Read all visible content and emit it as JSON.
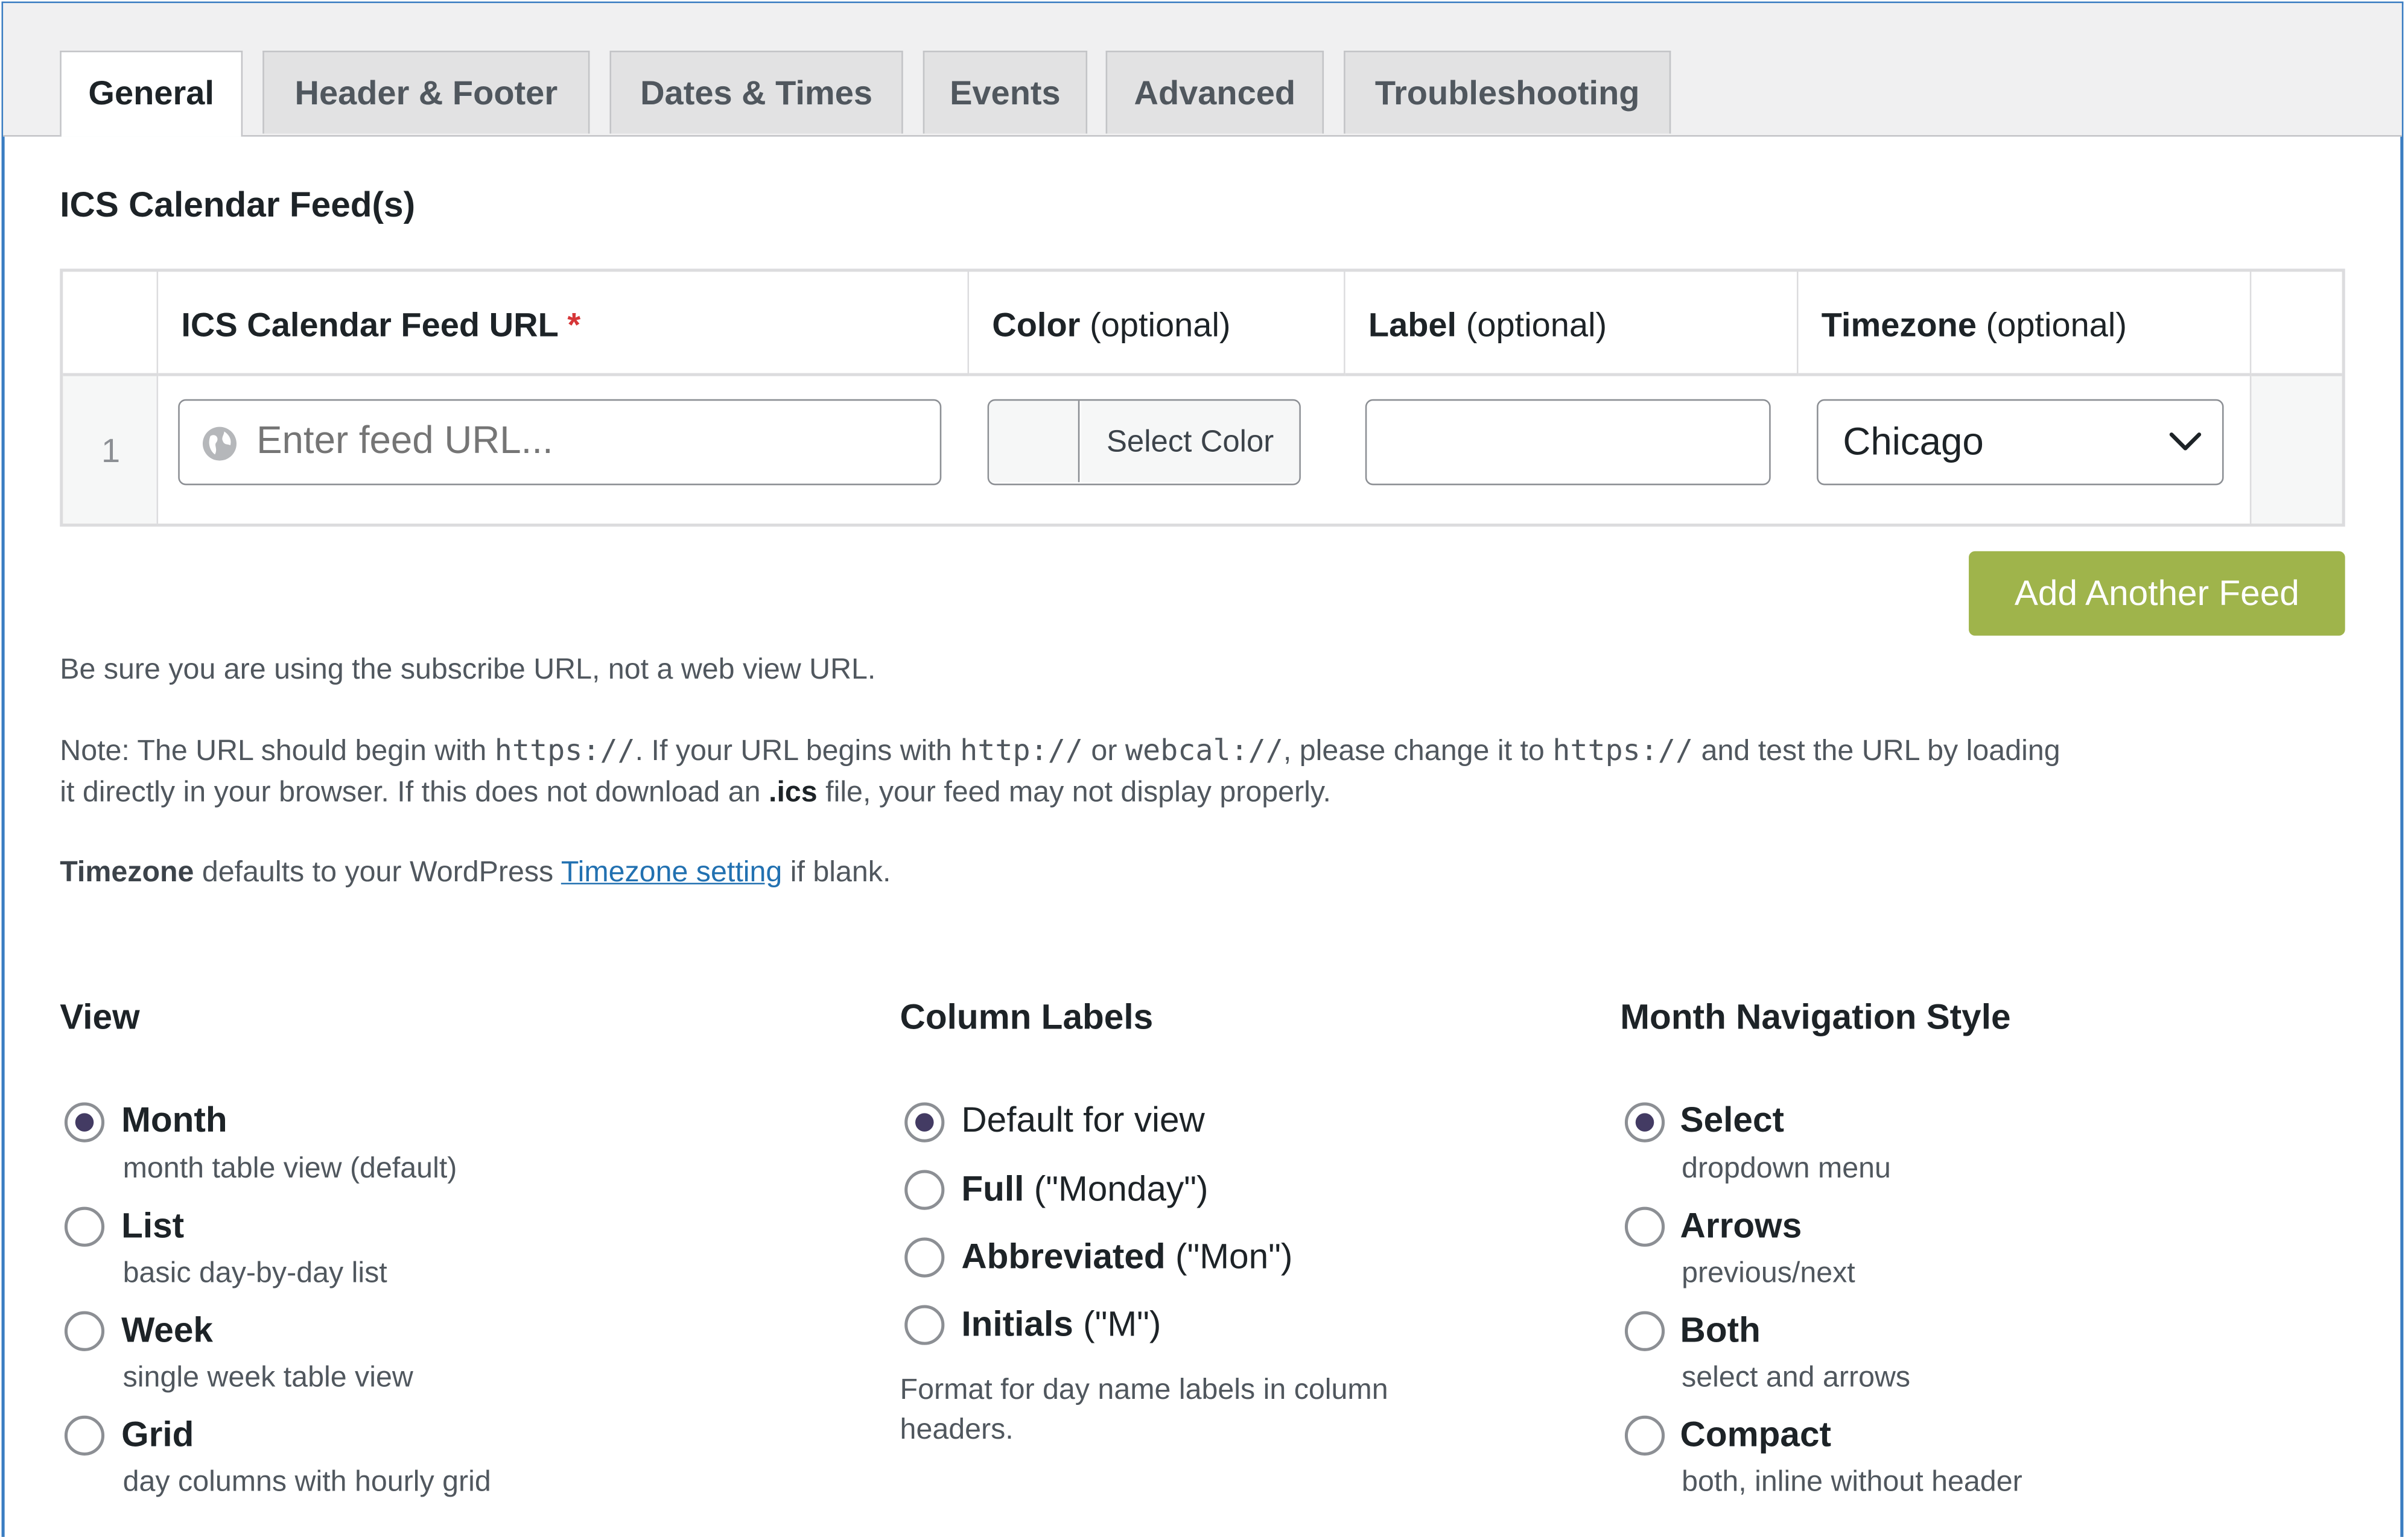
{
  "tabs": [
    "General",
    "Header & Footer",
    "Dates & Times",
    "Events",
    "Advanced",
    "Troubleshooting"
  ],
  "active_tab": "General",
  "feeds_section": {
    "title": "ICS Calendar Feed(s)",
    "columns": {
      "url": {
        "label": "ICS Calendar Feed URL",
        "required_mark": "*"
      },
      "color": {
        "label": "Color",
        "suffix": "(optional)"
      },
      "label": {
        "label": "Label",
        "suffix": "(optional)"
      },
      "timezone": {
        "label": "Timezone",
        "suffix": "(optional)"
      }
    },
    "row": {
      "number": "1",
      "url_placeholder": "Enter feed URL...",
      "url_value": "",
      "color_button": "Select Color",
      "label_value": "",
      "timezone_value": "Chicago"
    },
    "add_button": "Add Another Feed"
  },
  "notes": {
    "subscribe": "Be sure you are using the subscribe URL, not a web view URL.",
    "https_note": {
      "p1": "Note: The URL should begin with ",
      "c1": "https://",
      "p2": ". If your URL begins with ",
      "c2": "http://",
      "p3": " or ",
      "c3": "webcal://",
      "p4": ", please change it to ",
      "c4": "https://",
      "p5": " and test the URL by loading",
      "line2_a": "it directly in your browser. If this does not download an ",
      "ics": ".ics",
      "line2_b": " file, your feed may not display properly."
    },
    "timezone": {
      "bold": "Timezone",
      "p1": " defaults to your WordPress ",
      "link": "Timezone setting",
      "p2": " if blank."
    }
  },
  "view": {
    "title": "View",
    "options": [
      {
        "label": "Month",
        "desc": "month table view (default)",
        "checked": true
      },
      {
        "label": "List",
        "desc": "basic day-by-day list",
        "checked": false
      },
      {
        "label": "Week",
        "desc": "single week table view",
        "checked": false
      },
      {
        "label": "Grid",
        "desc": "day columns with hourly grid",
        "checked": false
      }
    ]
  },
  "column_labels": {
    "title": "Column Labels",
    "options": [
      {
        "label": "Default for view",
        "example": "",
        "checked": true
      },
      {
        "label": "Full",
        "example": " (\"Monday\")",
        "checked": false
      },
      {
        "label": "Abbreviated",
        "example": " (\"Mon\")",
        "checked": false
      },
      {
        "label": "Initials",
        "example": " (\"M\")",
        "checked": false
      }
    ],
    "help_line1": "Format for day name labels in column",
    "help_line2": "headers."
  },
  "month_nav": {
    "title": "Month Navigation Style",
    "options": [
      {
        "label": "Select",
        "desc": "dropdown menu",
        "checked": true
      },
      {
        "label": "Arrows",
        "desc": "previous/next",
        "checked": false
      },
      {
        "label": "Both",
        "desc": "select and arrows",
        "checked": false
      },
      {
        "label": "Compact",
        "desc": "both, inline without header",
        "checked": false
      }
    ]
  },
  "colors": {
    "frame_border": "#3a7dc2",
    "add_button": "#9fb44b",
    "radio_dot": "#433b63",
    "link": "#2271b1",
    "required": "#d63638"
  }
}
